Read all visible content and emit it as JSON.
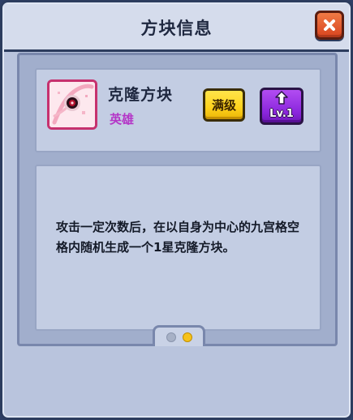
{
  "dialog": {
    "title": "方块信息",
    "close_icon": "close-x-icon"
  },
  "block": {
    "name": "克隆方块",
    "rarity": "英雄",
    "icon": "clone-block-icon",
    "max_label": "满级",
    "level_label": "Lv.1",
    "level_icon": "up-arrow-icon"
  },
  "description": {
    "text": "攻击一定次数后，在以自身为中心的九宫格空格内随机生成一个1星克隆方块。"
  },
  "pager": {
    "total_pages": 2,
    "current_page": 2
  },
  "colors": {
    "rarity": "#b436c7",
    "max_button": "#ffd21c",
    "level_button": "#8a26dc",
    "close_button": "#e05a2e",
    "active_dot": "#f6c21a"
  }
}
